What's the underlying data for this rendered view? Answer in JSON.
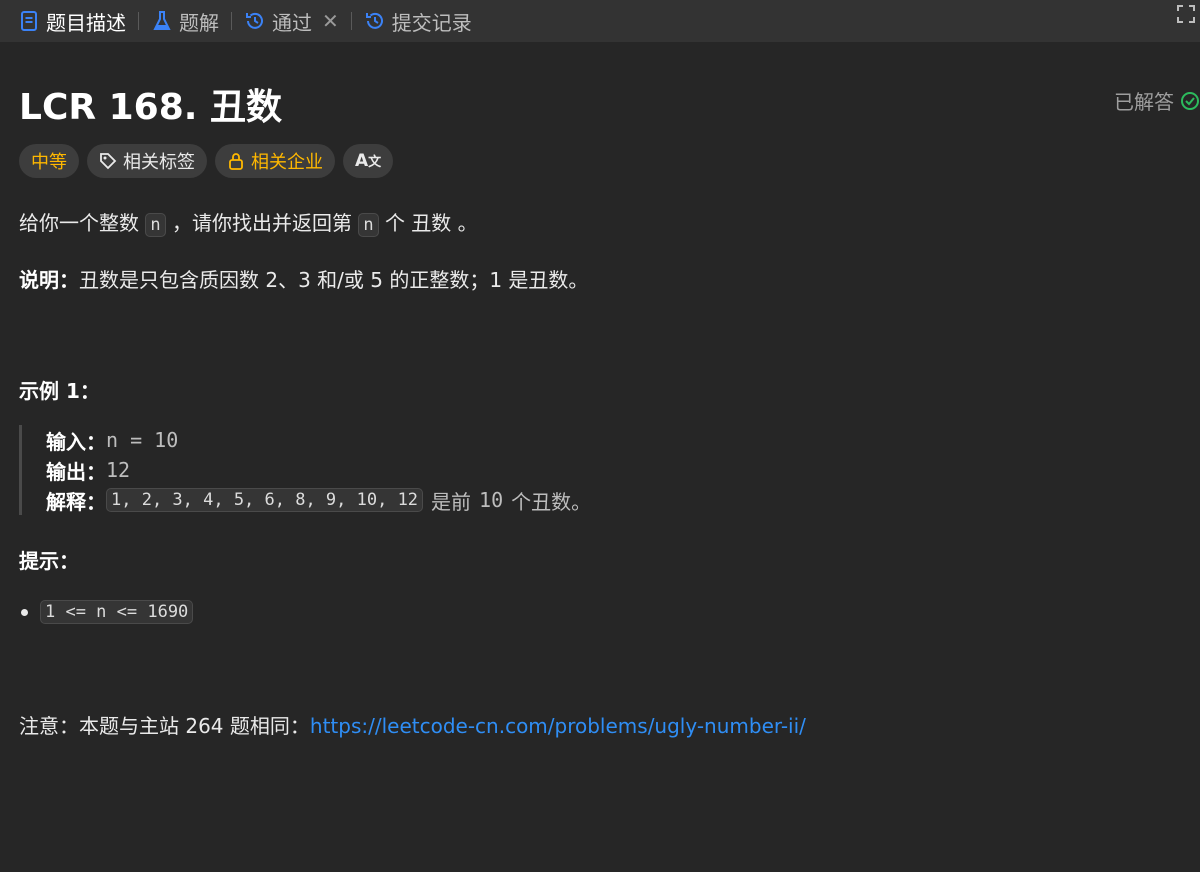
{
  "tabs": [
    {
      "label": "题目描述",
      "icon": "document-icon",
      "active": true
    },
    {
      "label": "题解",
      "icon": "flask-icon"
    },
    {
      "label": "通过",
      "icon": "history-icon",
      "closable": true
    },
    {
      "label": "提交记录",
      "icon": "history-icon"
    }
  ],
  "problem": {
    "title": "LCR 168. 丑数",
    "status": "已解答",
    "tags": {
      "difficulty": "中等",
      "topics": "相关标签",
      "companies": "相关企业",
      "translate": "A"
    },
    "desc": {
      "p1": "给你一个整数",
      "n1": "n",
      "p2": "，请你找出并返回第",
      "n2": "n",
      "p3": "个",
      "term": "丑数",
      "p4": "。"
    },
    "note": {
      "label": "说明：",
      "text": "丑数是只包含质因数 2、3 和/或 5 的正整数；1 是丑数。"
    },
    "example": {
      "heading": "示例 1：",
      "input_label": "输入：",
      "input_value": "n = 10",
      "output_label": "输出：",
      "output_value": "12",
      "explain_label": "解释：",
      "explain_code": "1, 2, 3, 4, 5, 6, 8, 9, 10, 12",
      "explain_text1": "是前",
      "explain_num": "10",
      "explain_text2": "个丑数。"
    },
    "hints": {
      "heading": "提示：",
      "items": [
        "1 <= n <= 1690"
      ]
    },
    "footer": {
      "text": "注意：本题与主站 264 题相同：",
      "link": "https://leetcode-cn.com/problems/ugly-number-ii/"
    }
  },
  "colors": {
    "accent_link": "#2f8ef5",
    "difficulty_medium": "#ffb800",
    "solved_check": "#2cbb5d"
  }
}
